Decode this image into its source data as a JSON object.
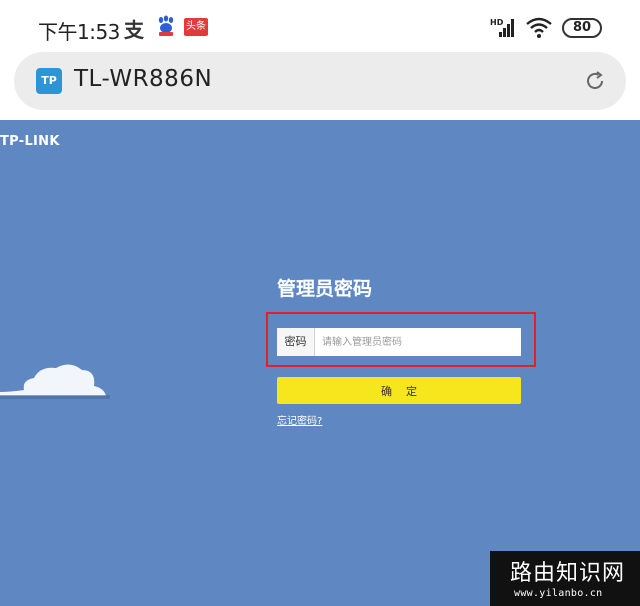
{
  "status_bar": {
    "time": "下午1:53",
    "notifications": [
      {
        "icon": "alipay-icon",
        "glyph": "支"
      },
      {
        "icon": "baidu-paw-icon"
      },
      {
        "icon": "toutiao-icon",
        "label": "头条"
      }
    ],
    "network": "HD",
    "battery": "80"
  },
  "address_bar": {
    "site_icon_label": "TP",
    "title": "TL-WR886N",
    "reload_icon": "reload-icon"
  },
  "page": {
    "brand_logo": "TP-LINK",
    "login_title": "管理员密码",
    "password_label": "密码",
    "password_placeholder": "请输入管理员密码",
    "password_value": "",
    "confirm_label": "确定",
    "forgot_link": "忘记密码?",
    "colors": {
      "background": "#5f87c2",
      "button": "#f5e61e",
      "highlight": "#e0202a"
    }
  },
  "watermark": {
    "title": "路由知识网",
    "url": "www.yilanbo.cn"
  }
}
